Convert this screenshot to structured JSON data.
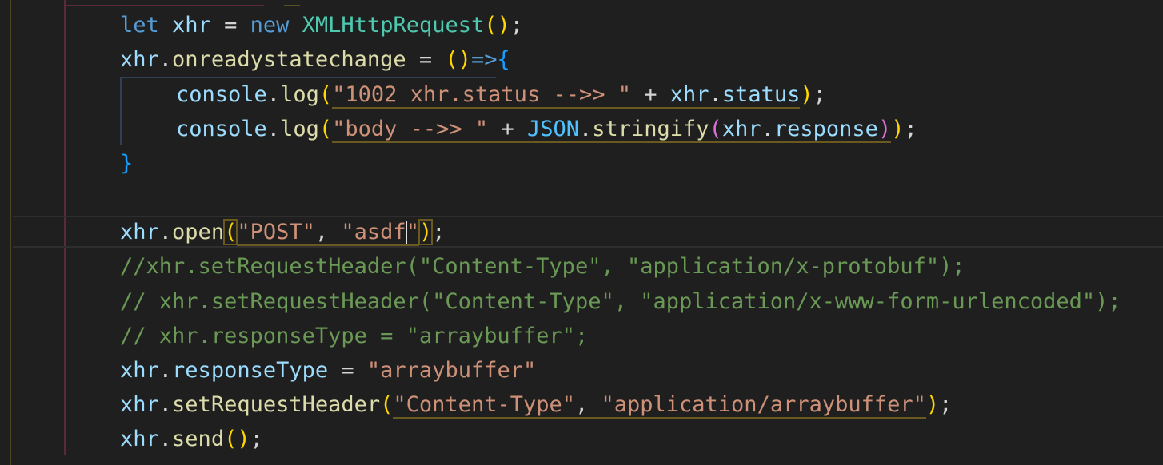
{
  "editor": {
    "language": "javascript",
    "lines": {
      "l1": {
        "kw_let": "let",
        "var": "xhr",
        "eq": " = ",
        "kw_new": "new",
        "cls": "XMLHttpRequest",
        "open": "(",
        "close": ")",
        "end": ";"
      },
      "l2": {
        "obj": "xhr",
        "dot": ".",
        "prop": "onreadystatechange",
        "eq": " = ",
        "paren_open": "(",
        "paren_close": ")",
        "arrow": "=>",
        "brace": "{"
      },
      "l3": {
        "obj": "console",
        "dot": ".",
        "fn": "log",
        "open": "(",
        "str": "\"1002 xhr.status -->> \"",
        "plus": " + ",
        "obj2": "xhr",
        "dot2": ".",
        "prop": "status",
        "close": ")",
        "end": ";"
      },
      "l4": {
        "obj": "console",
        "dot": ".",
        "fn": "log",
        "open": "(",
        "str": "\"body -->> \"",
        "plus": " + ",
        "obj2": "JSON",
        "dot2": ".",
        "fn2": "stringify",
        "open2": "(",
        "obj3": "xhr",
        "dot3": ".",
        "prop": "response",
        "close2": ")",
        "close": ")",
        "end": ";"
      },
      "l5": {
        "brace": "}"
      },
      "l7": {
        "obj": "xhr",
        "dot": ".",
        "fn": "open",
        "open": "(",
        "str1": "\"POST\"",
        "comma": ", ",
        "str2a": "\"asdf",
        "str2b": "\"",
        "close": ")",
        "end": ";"
      },
      "l8": {
        "comment": "//xhr.setRequestHeader(\"Content-Type\", \"application/x-protobuf\");"
      },
      "l9": {
        "comment": "// xhr.setRequestHeader(\"Content-Type\", \"application/x-www-form-urlencoded\");"
      },
      "l10": {
        "comment": "// xhr.responseType = \"arraybuffer\";"
      },
      "l11": {
        "obj": "xhr",
        "dot": ".",
        "prop": "responseType",
        "eq": " = ",
        "str": "\"arraybuffer\""
      },
      "l12": {
        "obj": "xhr",
        "dot": ".",
        "fn": "setRequestHeader",
        "open": "(",
        "str1": "\"Content-Type\"",
        "comma": ", ",
        "str2": "\"application/arraybuffer\"",
        "close": ")",
        "end": ";"
      },
      "l13": {
        "obj": "xhr",
        "dot": ".",
        "fn": "send",
        "open": "(",
        "close": ")",
        "end": ";"
      }
    }
  },
  "colors": {
    "background": "#1f1f1f",
    "keyword": "#569cd6",
    "variable": "#9cdcfe",
    "class": "#4ec9b0",
    "function": "#dcdcaa",
    "string": "#ce9178",
    "comment": "#6a9955",
    "bracket_level1": "#ffd700",
    "bracket_level2": "#da70d6",
    "bracket_level3": "#179fff"
  }
}
